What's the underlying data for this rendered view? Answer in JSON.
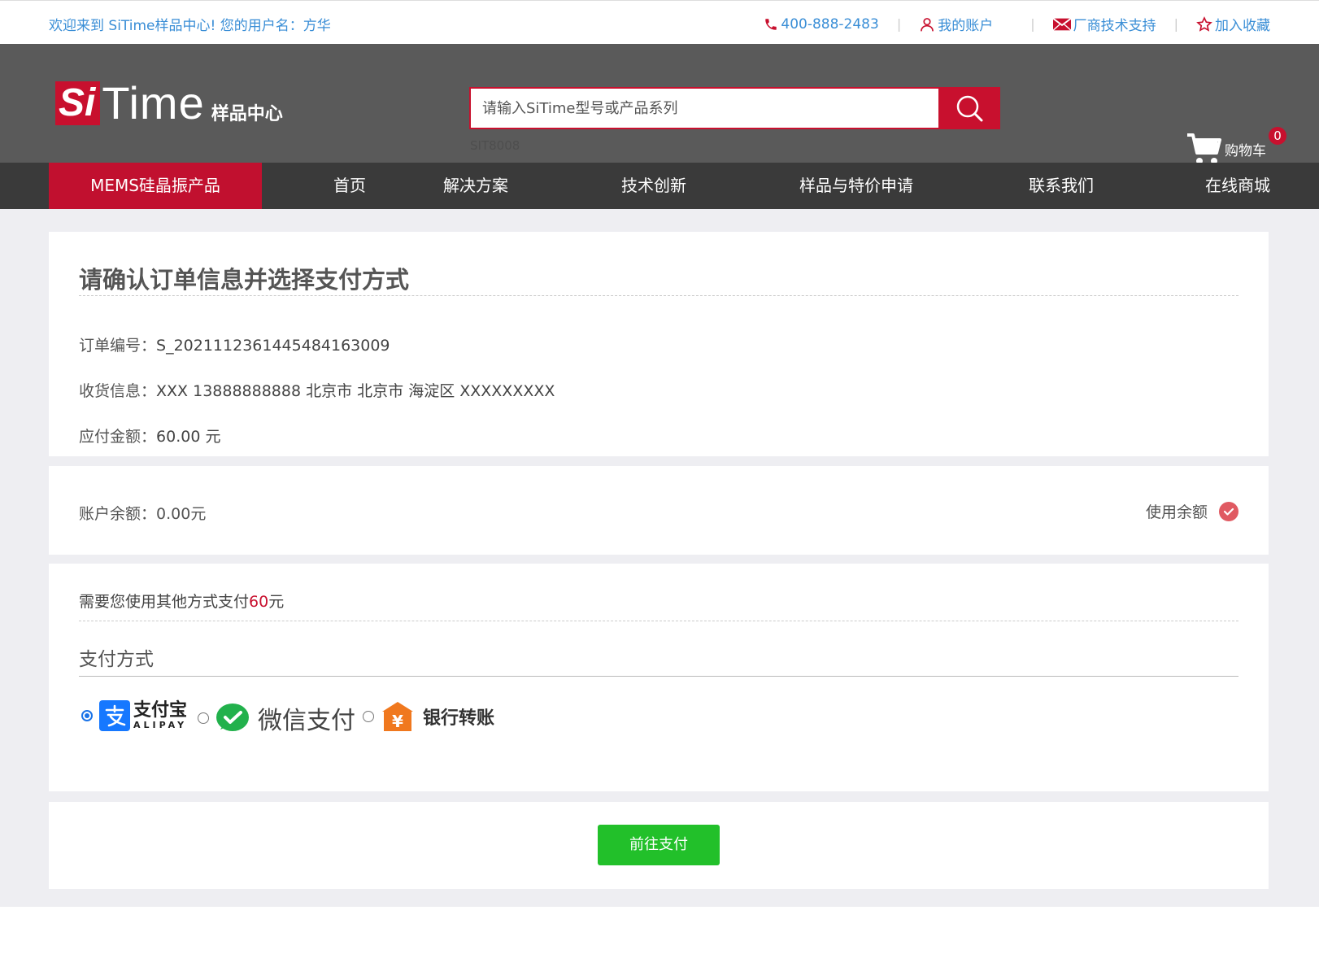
{
  "topbar": {
    "welcome": "欢迎来到 SiTime样品中心!  您的用户名：方华",
    "phone": "400-888-2483",
    "account": "我的账户",
    "support": "厂商技术支持",
    "favorite": "加入收藏",
    "separator": "|"
  },
  "header": {
    "logo_si": "Si",
    "logo_time": "Time",
    "logo_sub": "样品中心",
    "search_placeholder": "请输入SiTime型号或产品系列",
    "search_hint": "SIT8008",
    "cart_label": "购物车",
    "cart_count": "0"
  },
  "nav": {
    "items": [
      "MEMS硅晶振产品",
      "首页",
      "解决方案",
      "技术创新",
      "样品与特价申请",
      "联系我们",
      "在线商城"
    ]
  },
  "order": {
    "title": "请确认订单信息并选择支付方式",
    "number_label": "订单编号：",
    "number": "S_2021112361445484163009",
    "shipping_label": "收货信息：",
    "shipping": "XXX 13888888888 北京市 北京市 海淀区 XXXXXXXXX",
    "amount_label": "应付金额：",
    "amount": "60.00 元"
  },
  "balance": {
    "label": "账户余额：",
    "value": "0.00元",
    "use_label": "使用余额"
  },
  "payment": {
    "need_prefix": "需要您使用其他方式支付",
    "need_amount": "60",
    "need_suffix": "元",
    "title": "支付方式",
    "alipay_cn": "支付宝",
    "alipay_en": "ALIPAY",
    "wechat": "微信支付",
    "bank": "银行转账",
    "selected": "alipay"
  },
  "submit_label": "前往支付",
  "colors": {
    "brand_red": "#c8102e",
    "link_blue": "#3a8ed6",
    "pay_green": "#22c02a",
    "header_gray": "#5a5a5a",
    "nav_dark": "#3a3a3a"
  }
}
